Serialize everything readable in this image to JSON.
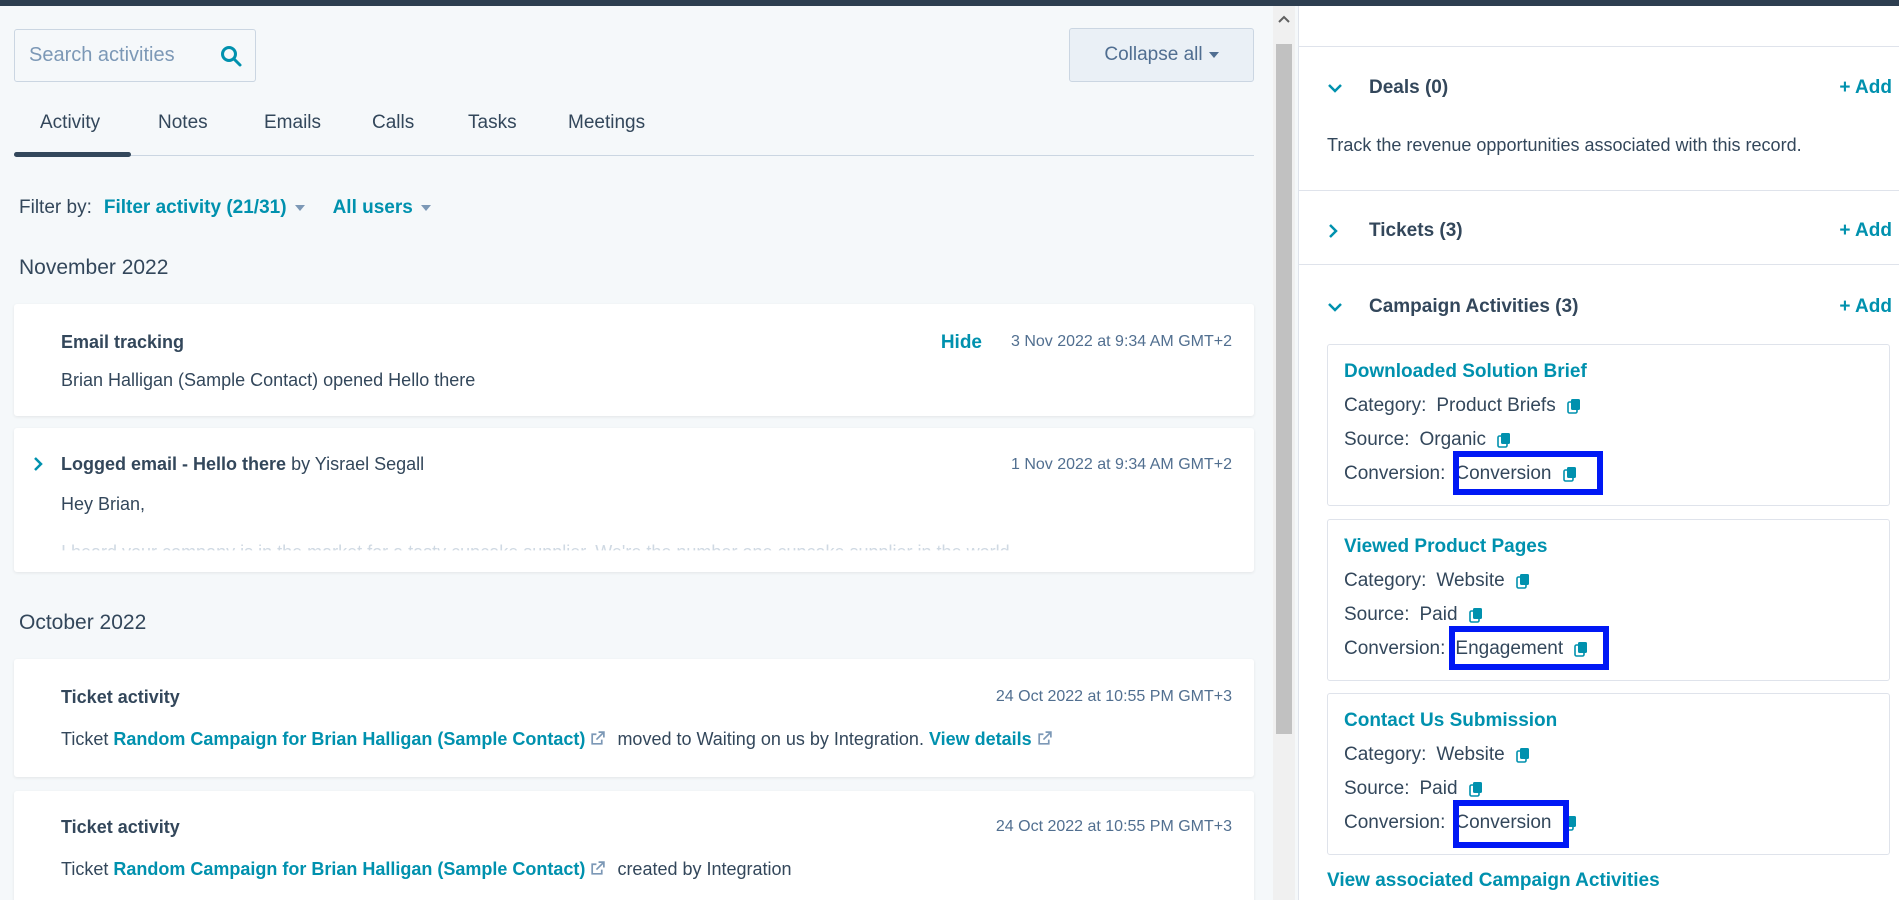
{
  "colors": {
    "accent": "#0091ae",
    "text": "#33475b",
    "highlight": "#0018f5"
  },
  "search": {
    "placeholder": "Search activities",
    "icon": "search-icon"
  },
  "collapse_all": "Collapse all",
  "tabs": [
    {
      "label": "Activity",
      "active": true
    },
    {
      "label": "Notes"
    },
    {
      "label": "Emails"
    },
    {
      "label": "Calls"
    },
    {
      "label": "Tasks"
    },
    {
      "label": "Meetings"
    }
  ],
  "filter": {
    "label": "Filter by:",
    "activity": "Filter activity (21/31)",
    "users": "All users"
  },
  "months": [
    "November 2022",
    "October 2022"
  ],
  "timeline": [
    {
      "title": "Email tracking",
      "hide": "Hide",
      "date": "3 Nov 2022 at 9:34 AM GMT+2",
      "text": "Brian Halligan (Sample Contact) opened Hello there"
    },
    {
      "title": "Logged email - Hello there",
      "by": "by Yisrael Segall",
      "date": "1 Nov 2022 at 9:34 AM GMT+2",
      "text": "Hey Brian,",
      "faded": "I heard your company is in the market for a tasty cupcake supplier. We're the number one cupcake supplier in the world."
    },
    {
      "title": "Ticket activity",
      "date": "24 Oct 2022 at 10:55 PM GMT+3",
      "pre": "Ticket",
      "link": "Random Campaign for Brian Halligan (Sample Contact)",
      "mid": "moved to Waiting on us by Integration.",
      "details": "View details"
    },
    {
      "title": "Ticket activity",
      "date": "24 Oct 2022 at 10:55 PM GMT+3",
      "pre": "Ticket",
      "link": "Random Campaign for Brian Halligan (Sample Contact)",
      "mid": "created by Integration"
    }
  ],
  "sidebar": {
    "deals": {
      "title": "Deals (0)",
      "add": "+ Add",
      "desc": "Track the revenue opportunities associated with this record."
    },
    "tickets": {
      "title": "Tickets (3)",
      "add": "+ Add"
    },
    "campaigns": {
      "title": "Campaign Activities (3)",
      "add": "+ Add",
      "labels": {
        "category": "Category:",
        "source": "Source:",
        "conversion": "Conversion:"
      },
      "items": [
        {
          "name": "Downloaded Solution Brief",
          "category": "Product Briefs",
          "source": "Organic",
          "conversion": "Conversion"
        },
        {
          "name": "Viewed Product Pages",
          "category": "Website",
          "source": "Paid",
          "conversion": "Engagement"
        },
        {
          "name": "Contact Us Submission",
          "category": "Website",
          "source": "Paid",
          "conversion": "Conversion"
        }
      ],
      "view_all": "View associated Campaign Activities"
    }
  }
}
